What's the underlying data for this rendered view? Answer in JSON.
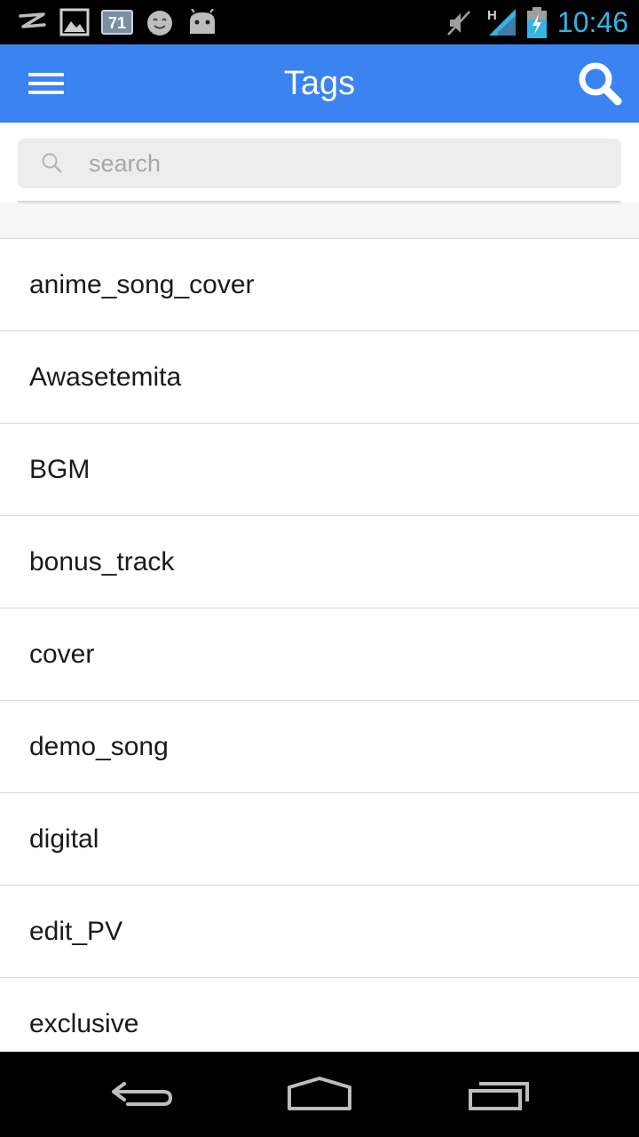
{
  "status_bar": {
    "time": "10:46",
    "notification_badge": "71",
    "time_color": "#33b5e5",
    "icons": [
      "zte-logo-icon",
      "image-icon",
      "calendar-71-icon",
      "smiley-icon",
      "android-icon",
      "mute-icon",
      "signal-h-icon",
      "battery-charging-icon"
    ]
  },
  "app_bar": {
    "title": "Tags",
    "background": "#3a83f0"
  },
  "search": {
    "placeholder": "search",
    "value": ""
  },
  "tags": [
    "anime_song_cover",
    "Awasetemita",
    "BGM",
    "bonus_track",
    "cover",
    "demo_song",
    "digital",
    "edit_PV",
    "exclusive"
  ],
  "nav_bar": {
    "icons": [
      "back-icon",
      "home-icon",
      "recent-apps-icon"
    ]
  }
}
